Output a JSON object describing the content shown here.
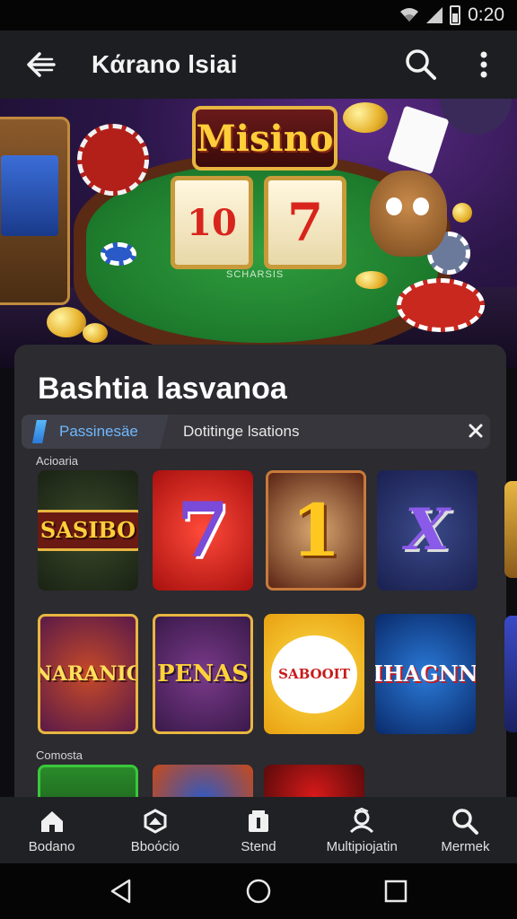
{
  "status_bar": {
    "time": "0:20"
  },
  "app_bar": {
    "title": "Kάrano lsiai"
  },
  "hero": {
    "sign_text": "Misino",
    "reel_1": "10",
    "reel_2": "7",
    "table_text": "SCHARSIS"
  },
  "card": {
    "title": "Bashtia lasvanoa",
    "tabs": [
      {
        "label": "Passinesäe"
      },
      {
        "label": "Dotitinge lsations"
      }
    ],
    "sections": [
      {
        "label": "Acioaria"
      },
      {
        "label": "Comosta"
      }
    ],
    "games": [
      {
        "label": "SASIBO"
      },
      {
        "label": "7"
      },
      {
        "label": "1"
      },
      {
        "label": "X"
      },
      {
        "label": "NARANIC"
      },
      {
        "label": "PENAS"
      },
      {
        "label": "SABOOIT"
      },
      {
        "label": "IHAGNN"
      }
    ]
  },
  "bottom_nav": {
    "items": [
      {
        "label": "Bodano",
        "icon": "home-icon"
      },
      {
        "label": "Bboόcio",
        "icon": "hexagon-icon"
      },
      {
        "label": "Stend",
        "icon": "store-icon"
      },
      {
        "label": "Multipiojatin",
        "icon": "people-icon"
      },
      {
        "label": "Mermek",
        "icon": "search-icon"
      }
    ]
  },
  "colors": {
    "app_bar": "#1d1e22",
    "card": "#2b2b30",
    "tab_accent": "#6fb8ff",
    "nav_bar": "#202125"
  }
}
